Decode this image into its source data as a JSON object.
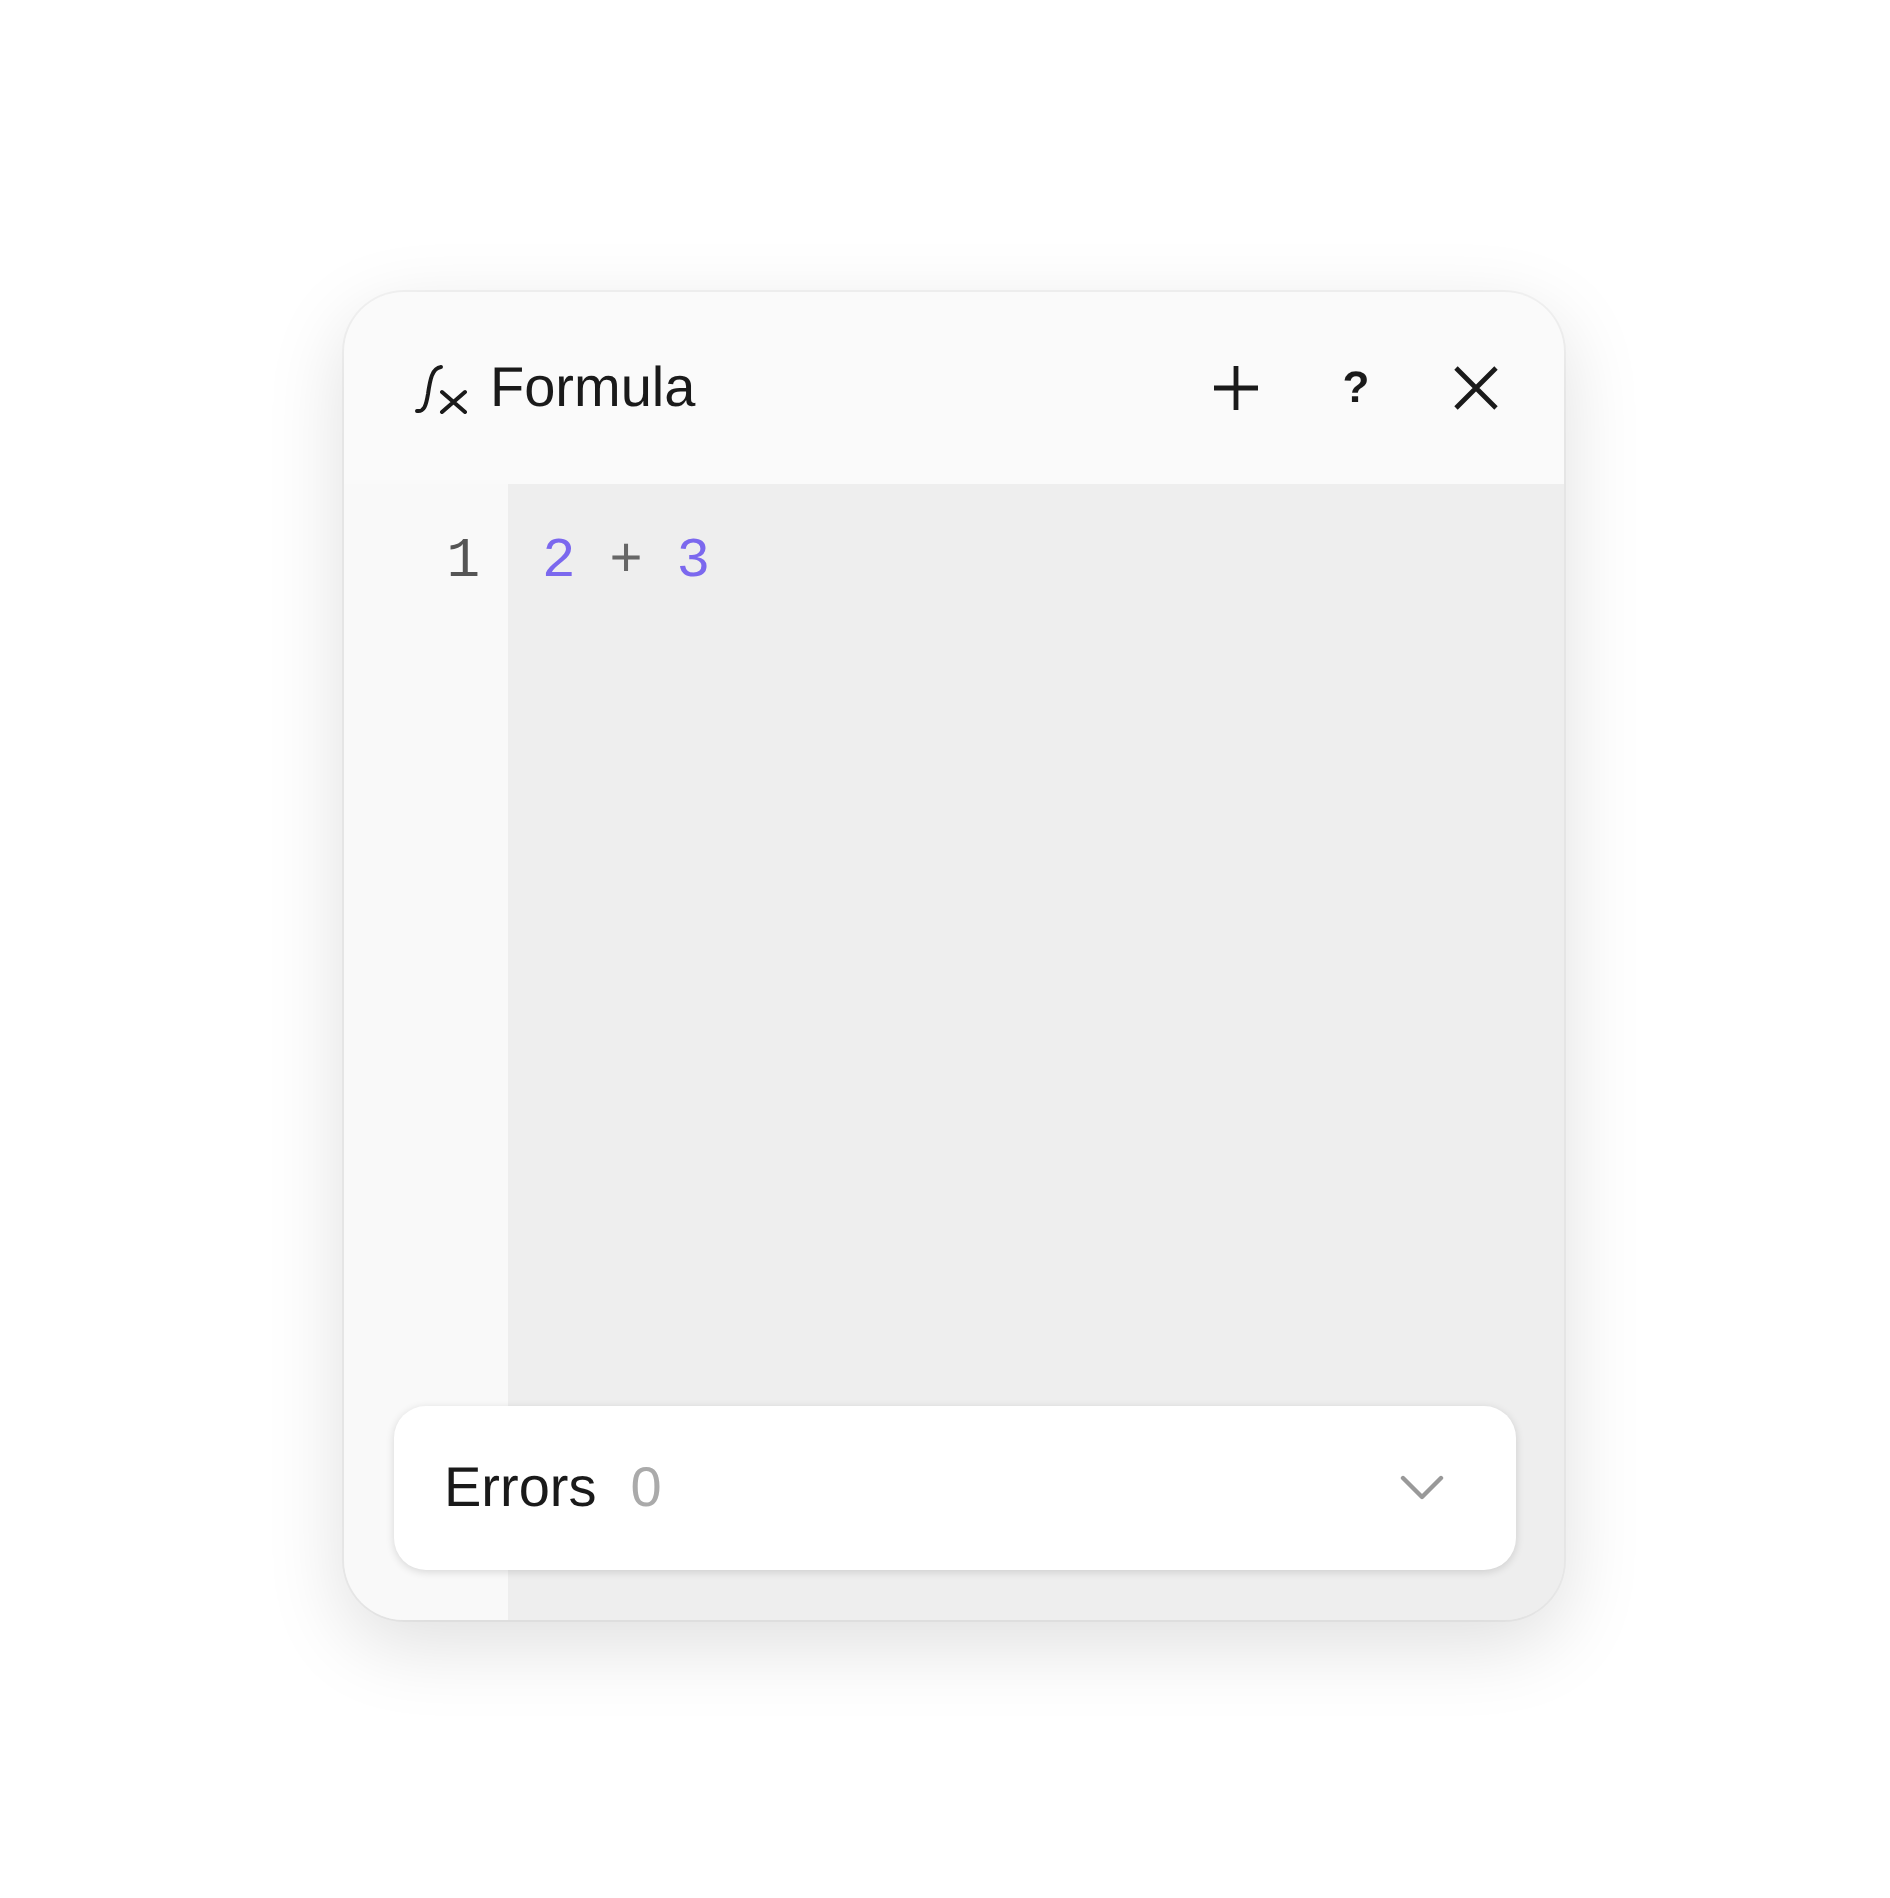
{
  "panel": {
    "title": "Formula",
    "header_buttons": [
      {
        "kind": "add"
      },
      {
        "kind": "help",
        "label": "?"
      },
      {
        "kind": "close"
      }
    ]
  },
  "editor": {
    "lines": [
      {
        "number": "1",
        "tokens": [
          {
            "text": "2",
            "kind": "number"
          },
          {
            "text": "+",
            "kind": "operator"
          },
          {
            "text": "3",
            "kind": "number"
          }
        ]
      }
    ]
  },
  "errors": {
    "label": "Errors",
    "count": "0",
    "expanded": false
  }
}
